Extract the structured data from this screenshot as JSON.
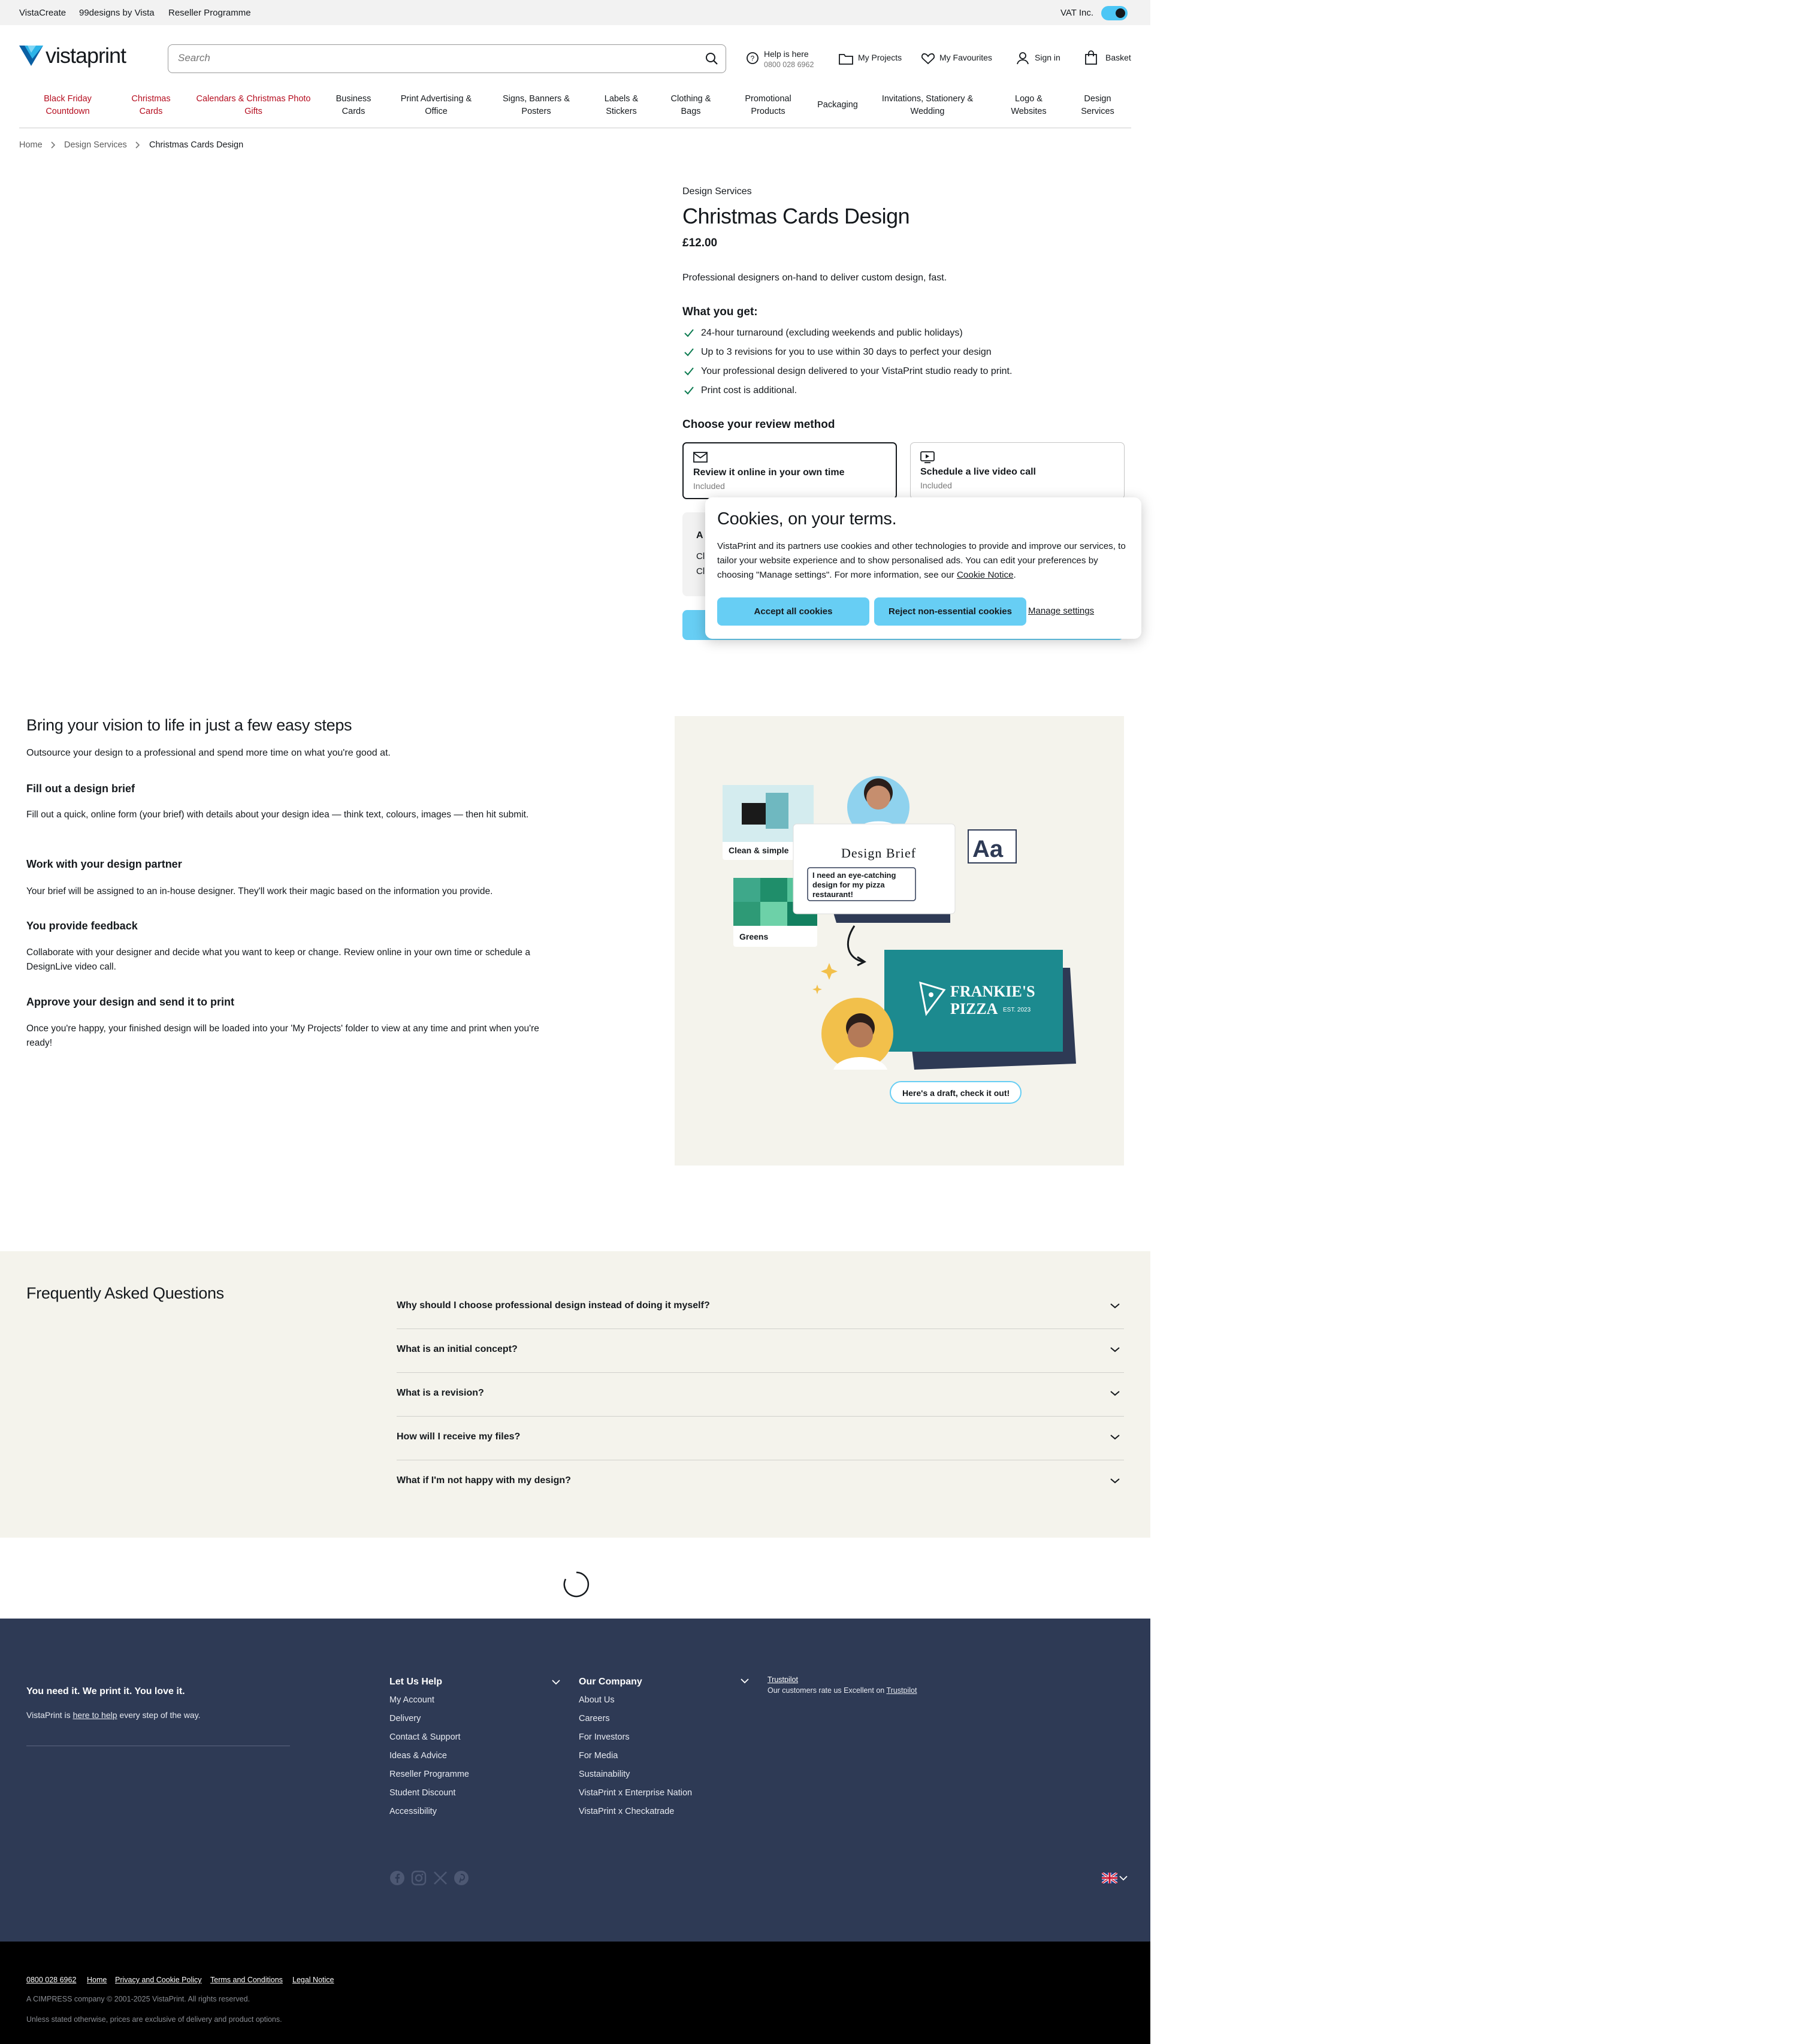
{
  "topbar": {
    "links": [
      "VistaCreate",
      "99designs by Vista",
      "Reseller Programme"
    ],
    "vat_label": "VAT Inc."
  },
  "header": {
    "logo_text": "vistaprint",
    "search_placeholder": "Search",
    "help_title": "Help is here",
    "help_phone": "0800 028 6962",
    "my_projects": "My Projects",
    "my_favourites": "My Favourites",
    "sign_in": "Sign in",
    "basket": "Basket"
  },
  "nav": {
    "items": [
      {
        "line1": "Black Friday",
        "line2": "Countdown",
        "highlight": true
      },
      {
        "line1": "Christmas",
        "line2": "Cards",
        "highlight": true
      },
      {
        "line1": "Calendars & Christmas Photo",
        "line2": "Gifts",
        "highlight": true
      },
      {
        "line1": "Business",
        "line2": "Cards",
        "highlight": false
      },
      {
        "line1": "Print Advertising &",
        "line2": "Office",
        "highlight": false
      },
      {
        "line1": "Signs, Banners &",
        "line2": "Posters",
        "highlight": false
      },
      {
        "line1": "Labels &",
        "line2": "Stickers",
        "highlight": false
      },
      {
        "line1": "Clothing &",
        "line2": "Bags",
        "highlight": false
      },
      {
        "line1": "Promotional",
        "line2": "Products",
        "highlight": false
      },
      {
        "line1": "Packaging",
        "line2": "",
        "highlight": false
      },
      {
        "line1": "Invitations, Stationery &",
        "line2": "Wedding",
        "highlight": false
      },
      {
        "line1": "Logo &",
        "line2": "Websites",
        "highlight": false
      },
      {
        "line1": "Design",
        "line2": "Services",
        "highlight": false
      }
    ]
  },
  "breadcrumb": {
    "items": [
      "Home",
      "Design Services",
      "Christmas Cards Design"
    ]
  },
  "product": {
    "eyebrow": "Design Services",
    "title": "Christmas Cards Design",
    "price": "£12.00",
    "description": "Professional designers on-hand to deliver custom design, fast.",
    "what_you_get_title": "What you get:",
    "features": [
      "24-hour turnaround (excluding weekends and public holidays)",
      "Up to 3 revisions for you to use within 30 days to perfect your design",
      "Your professional design delivered to your VistaPrint studio ready to print.",
      "Print cost is additional."
    ],
    "review_title": "Choose your review method",
    "review_options": [
      {
        "title": "Review it online in your own time",
        "sub": "Included",
        "selected": true
      },
      {
        "title": "Schedule a live video call",
        "sub": "Included",
        "selected": false
      }
    ],
    "partial_letters": [
      "A",
      "Cl",
      "Cl"
    ]
  },
  "cookie": {
    "title": "Cookies, on your terms.",
    "body": "VistaPrint and its partners use cookies and other technologies to provide and improve our services, to tailor your website experience and to show personalised ads. You can edit your preferences by choosing \"Manage settings\". For more information, see our",
    "notice_link": "Cookie Notice",
    "accept": "Accept all cookies",
    "reject": "Reject non-essential cookies",
    "manage": "Manage settings"
  },
  "steps": {
    "title": "Bring your vision to life in just a few easy steps",
    "subtitle": "Outsource your design to a professional and spend more time on what you're good at.",
    "items": [
      {
        "title": "Fill out a design brief",
        "body": "Fill out a quick, online form (your brief) with details about your design idea — think text, colours, images — then hit submit."
      },
      {
        "title": "Work with your design partner",
        "body": "Your brief will be assigned to an in-house designer. They'll work their magic based on the information you provide."
      },
      {
        "title": "You provide feedback",
        "body": "Collaborate with your designer and decide what you want to keep or change. Review online in your own time or schedule a DesignLive video call."
      },
      {
        "title": "Approve your design and send it to print",
        "body": "Once you're happy, your finished design will be loaded into your 'My Projects' folder to view at any time and print when you're ready!"
      }
    ]
  },
  "illustration": {
    "card1_label": "Clean & simple",
    "card2_label": "Greens",
    "brief_title": "Design Brief",
    "brief_text": "I need an eye-catching design for my pizza restaurant!",
    "font_sample": "Aa",
    "brand_line1": "FRANKIE'S",
    "brand_line2": "PIZZA",
    "brand_est": "EST. 2023",
    "bubble": "Here's a draft, check it out!"
  },
  "faq": {
    "title": "Frequently Asked Questions",
    "questions": [
      "Why should I choose professional design instead of doing it myself?",
      "What is an initial concept?",
      "What is a revision?",
      "How will I receive my files?",
      "What if I'm not happy with my design?"
    ]
  },
  "footer": {
    "tagline": "You need it. We print it. You love it.",
    "help_pre": "VistaPrint is",
    "help_link": "here to help",
    "help_post": "every step of the way.",
    "col1_title": "Let Us Help",
    "col1": [
      "My Account",
      "Delivery",
      "Contact & Support",
      "Ideas & Advice",
      "Reseller Programme",
      "Student Discount",
      "Accessibility"
    ],
    "col2_title": "Our Company",
    "col2": [
      "About Us",
      "Careers",
      "For Investors",
      "For Media",
      "Sustainability",
      "VistaPrint x Enterprise Nation",
      "VistaPrint x Checkatrade"
    ],
    "trustpilot": "Trustpilot",
    "trust_text_pre": "Our customers rate us Excellent on",
    "trust_link": "Trustpilot",
    "social": [
      "facebook-icon",
      "instagram-icon",
      "x-icon",
      "pinterest-icon"
    ]
  },
  "bottom": {
    "links": [
      "0800 028 6962",
      "Home",
      "Privacy and Cookie Policy",
      "Terms and Conditions",
      "Legal Notice"
    ],
    "copyright": "A CIMPRESS company © 2001-2025 VistaPrint. All rights reserved.",
    "disclaimer": "Unless stated otherwise, prices are exclusive of delivery and product options."
  },
  "colors": {
    "accent": "#67cef4",
    "highlight_nav": "#b50d1f",
    "footer_bg": "#2e3a55",
    "brand_teal": "#1c8a8f",
    "check_green": "#0a7a4f"
  }
}
